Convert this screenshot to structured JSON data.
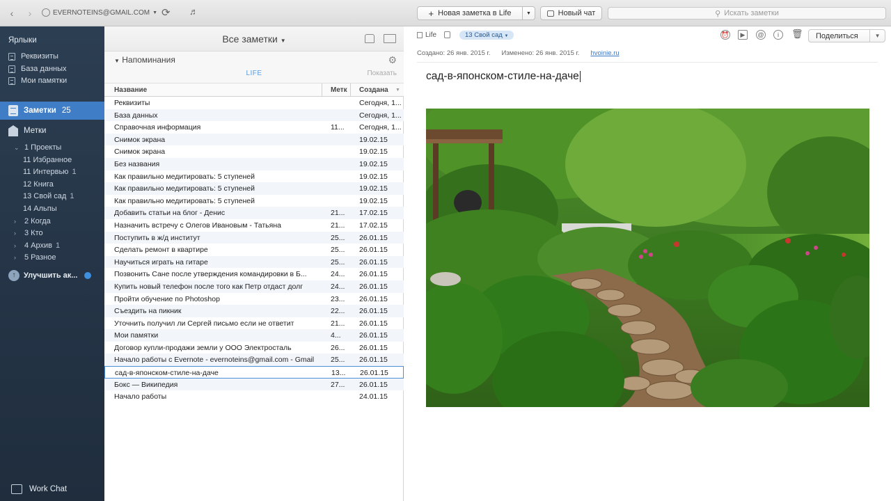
{
  "toolbar": {
    "account_email": "EVERNOTEINS@GMAIL.COM",
    "new_note_label": "Новая заметка в Life",
    "new_chat_label": "Новый чат",
    "search_placeholder": "Искать заметки"
  },
  "sidebar": {
    "shortcuts_heading": "Ярлыки",
    "shortcuts": [
      "Реквизиты",
      "База данных",
      "Мои памятки"
    ],
    "notes_label": "Заметки",
    "notes_count": "25",
    "tags_label": "Метки",
    "tags": [
      {
        "label": "1 Проекты",
        "count": "",
        "level": 0,
        "caret": "expanded"
      },
      {
        "label": "11 Избранное",
        "count": "",
        "level": 1,
        "caret": ""
      },
      {
        "label": "11 Интервью",
        "count": "1",
        "level": 1,
        "caret": ""
      },
      {
        "label": "12 Книга",
        "count": "",
        "level": 1,
        "caret": ""
      },
      {
        "label": "13 Свой сад",
        "count": "1",
        "level": 1,
        "caret": ""
      },
      {
        "label": "14 Альпы",
        "count": "",
        "level": 1,
        "caret": ""
      },
      {
        "label": "2 Когда",
        "count": "",
        "level": 0,
        "caret": "collapsed"
      },
      {
        "label": "3 Кто",
        "count": "",
        "level": 0,
        "caret": "collapsed"
      },
      {
        "label": "4 Архив",
        "count": "1",
        "level": 0,
        "caret": "collapsed"
      },
      {
        "label": "5 Разное",
        "count": "",
        "level": 0,
        "caret": "collapsed"
      }
    ],
    "upgrade_label": "Улучшить ак...",
    "work_chat_label": "Work Chat"
  },
  "list": {
    "title": "Все заметки",
    "reminders_label": "Напоминания",
    "reminders_notebook": "LIFE",
    "reminders_show": "Показать",
    "columns": {
      "name": "Название",
      "tags": "Метк",
      "created": "Создана"
    },
    "rows": [
      {
        "name": "Реквизиты",
        "tag": "",
        "date": "Сегодня, 1..."
      },
      {
        "name": "База данных",
        "tag": "",
        "date": "Сегодня, 1..."
      },
      {
        "name": "Справочная информация",
        "tag": "11...",
        "date": "Сегодня, 1..."
      },
      {
        "name": "Снимок экрана",
        "tag": "",
        "date": "19.02.15"
      },
      {
        "name": "Снимок экрана",
        "tag": "",
        "date": "19.02.15"
      },
      {
        "name": "Без названия",
        "tag": "",
        "date": "19.02.15"
      },
      {
        "name": "Как правильно медитировать: 5 ступеней",
        "tag": "",
        "date": "19.02.15"
      },
      {
        "name": "Как правильно медитировать: 5 ступеней",
        "tag": "",
        "date": "19.02.15"
      },
      {
        "name": "Как правильно медитировать: 5 ступеней",
        "tag": "",
        "date": "19.02.15"
      },
      {
        "name": "Добавить статьи на блог - Денис",
        "tag": "21...",
        "date": "17.02.15"
      },
      {
        "name": "Назначить встречу с Олегов Ивановым - Татьяна",
        "tag": "21...",
        "date": "17.02.15"
      },
      {
        "name": "Поступить в ж/д институт",
        "tag": "25...",
        "date": "26.01.15"
      },
      {
        "name": "Сделать ремонт в квартире",
        "tag": "25...",
        "date": "26.01.15"
      },
      {
        "name": "Научиться играть на гитаре",
        "tag": "25...",
        "date": "26.01.15"
      },
      {
        "name": "Позвонить Сане после утверждения командировки в Б...",
        "tag": "24...",
        "date": "26.01.15"
      },
      {
        "name": "Купить новый телефон после того как Петр отдаст долг",
        "tag": "24...",
        "date": "26.01.15"
      },
      {
        "name": "Пройти обучение по Photoshop",
        "tag": "23...",
        "date": "26.01.15"
      },
      {
        "name": "Съездить на пикник",
        "tag": "22...",
        "date": "26.01.15"
      },
      {
        "name": "Уточнить получил ли Сергей письмо если не ответит",
        "tag": "21...",
        "date": "26.01.15"
      },
      {
        "name": "Мои памятки",
        "tag": "4...",
        "date": "26.01.15"
      },
      {
        "name": "Договор купли-продажи земли у ООО Электросталь",
        "tag": "26...",
        "date": "26.01.15"
      },
      {
        "name": "Начало работы с Evernote - evernoteins@gmail.com - Gmail",
        "tag": "25...",
        "date": "26.01.15"
      },
      {
        "name": "сад-в-японском-стиле-на-даче",
        "tag": "13...",
        "date": "26.01.15"
      },
      {
        "name": "Бокс — Википедия",
        "tag": "27...",
        "date": "26.01.15"
      },
      {
        "name": "Начало работы",
        "tag": "",
        "date": "24.01.15"
      }
    ],
    "selected_index": 22
  },
  "note": {
    "notebook": "Life",
    "tag": "13 Свой сад",
    "share_label": "Поделиться",
    "created": "Создано: 26 янв. 2015 г.",
    "modified": "Изменено: 26 янв. 2015 г.",
    "source": "hvoinie.ru",
    "title": "сад-в-японском-стиле-на-даче"
  },
  "colors": {
    "sidebar_bg": "#2c3e52",
    "sidebar_selected": "#3f7ec7",
    "link": "#3a78c4"
  }
}
